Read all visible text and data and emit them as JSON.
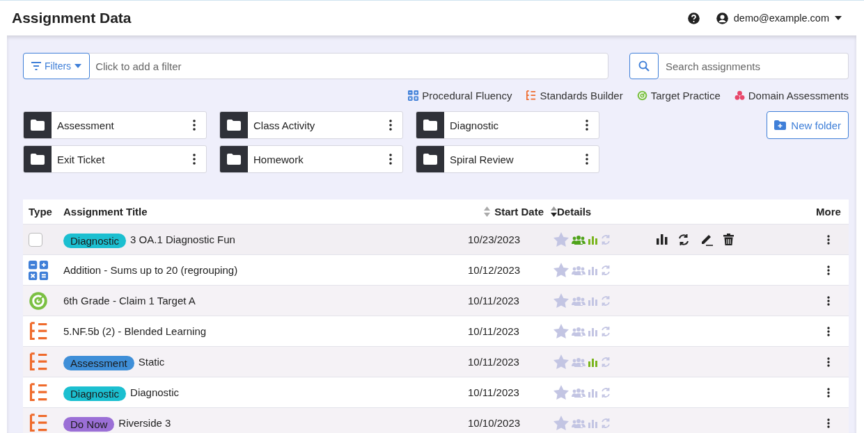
{
  "header": {
    "title": "Assignment Data",
    "user": "demo@example.com"
  },
  "filter": {
    "button": "Filters",
    "placeholder": "Click to add a filter"
  },
  "search": {
    "placeholder": "Search assignments"
  },
  "links": [
    {
      "kind": "fluency",
      "label": "Procedural Fluency"
    },
    {
      "kind": "standards",
      "label": "Standards Builder"
    },
    {
      "kind": "target",
      "label": "Target Practice"
    },
    {
      "kind": "domain",
      "label": "Domain Assessments"
    }
  ],
  "folders": [
    {
      "name": "Assessment"
    },
    {
      "name": "Class Activity"
    },
    {
      "name": "Diagnostic"
    },
    {
      "name": "Exit Ticket"
    },
    {
      "name": "Homework"
    },
    {
      "name": "Spiral Review"
    }
  ],
  "new_folder": "New folder",
  "table": {
    "columns": [
      "Type",
      "Assignment Title",
      "Start Date",
      "Details",
      "More"
    ],
    "rows": [
      {
        "kind": "checkbox",
        "checked": false,
        "tag": {
          "text": "Diagnostic",
          "color": "#1bbfd0"
        },
        "title": "3 OA.1 Diagnostic Fun",
        "date": "10/23/2023",
        "assigned": true,
        "reported": true,
        "hovered": true
      },
      {
        "kind": "fluency",
        "title": "Addition - Sums up to 20 (regrouping)",
        "date": "10/12/2023",
        "assigned": false,
        "reported": false,
        "hovered": false
      },
      {
        "kind": "target",
        "title": "6th Grade - Claim 1 Target A",
        "date": "10/11/2023",
        "assigned": false,
        "reported": false,
        "hovered": false
      },
      {
        "kind": "standards",
        "title": "5.NF.5b (2) - Blended Learning",
        "date": "10/11/2023",
        "assigned": false,
        "reported": false,
        "hovered": false
      },
      {
        "kind": "standards",
        "tag": {
          "text": "Assessment",
          "color": "#3f8fd8"
        },
        "title": "Static",
        "date": "10/11/2023",
        "assigned": false,
        "reported": true,
        "hovered": false
      },
      {
        "kind": "standards",
        "tag": {
          "text": "Diagnostic",
          "color": "#1bbfd0"
        },
        "title": "Diagnostic",
        "date": "10/11/2023",
        "assigned": false,
        "reported": false,
        "hovered": false
      },
      {
        "kind": "standards",
        "tag": {
          "text": "Do Now",
          "color": "#9b6fd6"
        },
        "title": "Riverside 3",
        "date": "10/10/2023",
        "assigned": false,
        "reported": false,
        "hovered": false
      }
    ]
  }
}
